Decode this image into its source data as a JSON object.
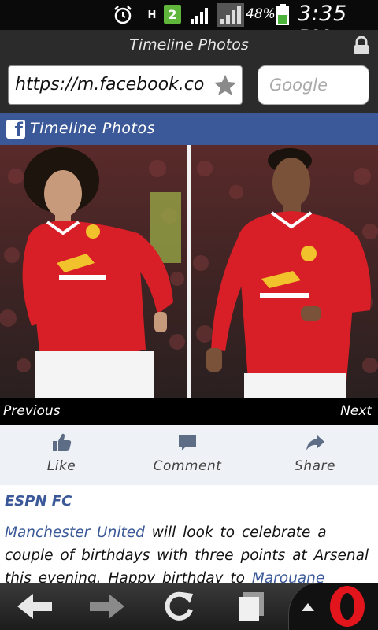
{
  "status_bar": {
    "network_type": "H",
    "sim_slot": "2",
    "battery_percent": "48%",
    "time": "3:35 PM",
    "icons": [
      "alarm-icon",
      "data-arrows-icon",
      "sim-icon",
      "signal-icon",
      "signal-icon-2",
      "battery-icon"
    ]
  },
  "browser": {
    "page_title": "Timeline Photos",
    "url": "https://m.facebook.co",
    "search_placeholder": "Google"
  },
  "facebook": {
    "header_title": "Timeline Photos",
    "logo_letter": "f",
    "brand_color": "#3b5998"
  },
  "photo_viewer": {
    "prev_label": "Previous",
    "next_label": "Next"
  },
  "actions": {
    "like_label": "Like",
    "comment_label": "Comment",
    "share_label": "Share"
  },
  "post": {
    "author": "ESPN FC",
    "text_link_1": "Manchester United",
    "text_part_1": " will look to celebrate a couple of birthdays with three points at Arsenal this evening. Happy birthday to ",
    "text_link_2": "Marouane Fellaini"
  }
}
